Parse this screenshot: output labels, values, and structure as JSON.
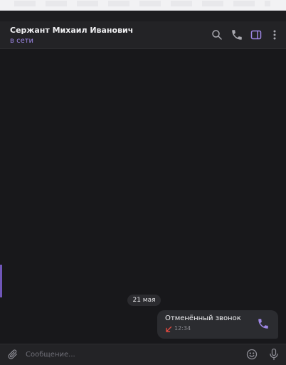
{
  "colors": {
    "accent": "#9d86e4",
    "background": "#18181b",
    "header": "#232326",
    "bubble": "#2b2c30",
    "missed_call": "#e0483f"
  },
  "header": {
    "title": "Сержант Михаил Иванович",
    "status": "в сети",
    "icons": [
      "search-icon",
      "phone-icon",
      "sidebar-panel-icon",
      "more-vertical-icon"
    ]
  },
  "chat": {
    "date_label": "21 мая",
    "message": {
      "label": "Отменённый звонок",
      "time": "12:34",
      "direction_icon": "missed-call-arrow-icon",
      "action_icon": "phone-icon"
    }
  },
  "composer": {
    "placeholder": "Сообщение...",
    "value": "",
    "icons": [
      "paperclip-icon",
      "emoji-icon",
      "microphone-icon"
    ]
  }
}
